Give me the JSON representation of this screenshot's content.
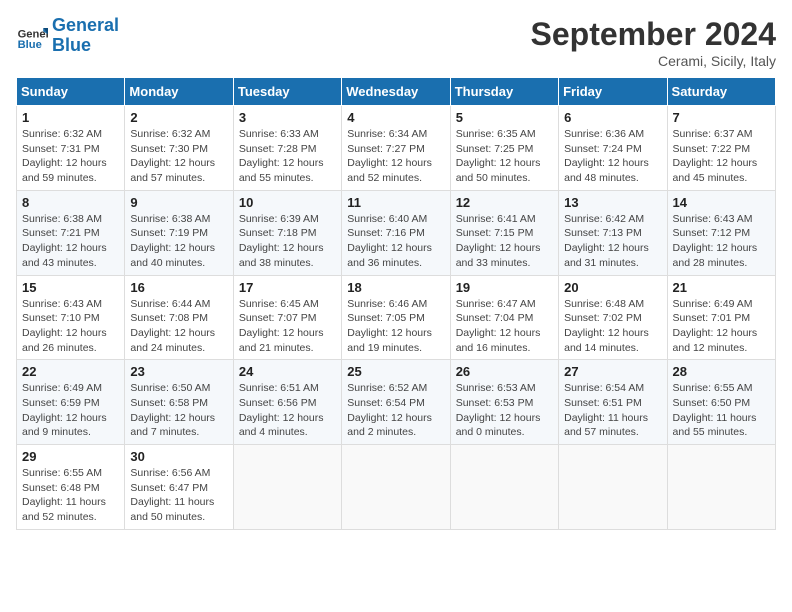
{
  "logo": {
    "general": "General",
    "blue": "Blue"
  },
  "header": {
    "month": "September 2024",
    "location": "Cerami, Sicily, Italy"
  },
  "weekdays": [
    "Sunday",
    "Monday",
    "Tuesday",
    "Wednesday",
    "Thursday",
    "Friday",
    "Saturday"
  ],
  "weeks": [
    [
      {
        "day": 1,
        "sunrise": "6:32 AM",
        "sunset": "7:31 PM",
        "daylight": "12 hours and 59 minutes."
      },
      {
        "day": 2,
        "sunrise": "6:32 AM",
        "sunset": "7:30 PM",
        "daylight": "12 hours and 57 minutes."
      },
      {
        "day": 3,
        "sunrise": "6:33 AM",
        "sunset": "7:28 PM",
        "daylight": "12 hours and 55 minutes."
      },
      {
        "day": 4,
        "sunrise": "6:34 AM",
        "sunset": "7:27 PM",
        "daylight": "12 hours and 52 minutes."
      },
      {
        "day": 5,
        "sunrise": "6:35 AM",
        "sunset": "7:25 PM",
        "daylight": "12 hours and 50 minutes."
      },
      {
        "day": 6,
        "sunrise": "6:36 AM",
        "sunset": "7:24 PM",
        "daylight": "12 hours and 48 minutes."
      },
      {
        "day": 7,
        "sunrise": "6:37 AM",
        "sunset": "7:22 PM",
        "daylight": "12 hours and 45 minutes."
      }
    ],
    [
      {
        "day": 8,
        "sunrise": "6:38 AM",
        "sunset": "7:21 PM",
        "daylight": "12 hours and 43 minutes."
      },
      {
        "day": 9,
        "sunrise": "6:38 AM",
        "sunset": "7:19 PM",
        "daylight": "12 hours and 40 minutes."
      },
      {
        "day": 10,
        "sunrise": "6:39 AM",
        "sunset": "7:18 PM",
        "daylight": "12 hours and 38 minutes."
      },
      {
        "day": 11,
        "sunrise": "6:40 AM",
        "sunset": "7:16 PM",
        "daylight": "12 hours and 36 minutes."
      },
      {
        "day": 12,
        "sunrise": "6:41 AM",
        "sunset": "7:15 PM",
        "daylight": "12 hours and 33 minutes."
      },
      {
        "day": 13,
        "sunrise": "6:42 AM",
        "sunset": "7:13 PM",
        "daylight": "12 hours and 31 minutes."
      },
      {
        "day": 14,
        "sunrise": "6:43 AM",
        "sunset": "7:12 PM",
        "daylight": "12 hours and 28 minutes."
      }
    ],
    [
      {
        "day": 15,
        "sunrise": "6:43 AM",
        "sunset": "7:10 PM",
        "daylight": "12 hours and 26 minutes."
      },
      {
        "day": 16,
        "sunrise": "6:44 AM",
        "sunset": "7:08 PM",
        "daylight": "12 hours and 24 minutes."
      },
      {
        "day": 17,
        "sunrise": "6:45 AM",
        "sunset": "7:07 PM",
        "daylight": "12 hours and 21 minutes."
      },
      {
        "day": 18,
        "sunrise": "6:46 AM",
        "sunset": "7:05 PM",
        "daylight": "12 hours and 19 minutes."
      },
      {
        "day": 19,
        "sunrise": "6:47 AM",
        "sunset": "7:04 PM",
        "daylight": "12 hours and 16 minutes."
      },
      {
        "day": 20,
        "sunrise": "6:48 AM",
        "sunset": "7:02 PM",
        "daylight": "12 hours and 14 minutes."
      },
      {
        "day": 21,
        "sunrise": "6:49 AM",
        "sunset": "7:01 PM",
        "daylight": "12 hours and 12 minutes."
      }
    ],
    [
      {
        "day": 22,
        "sunrise": "6:49 AM",
        "sunset": "6:59 PM",
        "daylight": "12 hours and 9 minutes."
      },
      {
        "day": 23,
        "sunrise": "6:50 AM",
        "sunset": "6:58 PM",
        "daylight": "12 hours and 7 minutes."
      },
      {
        "day": 24,
        "sunrise": "6:51 AM",
        "sunset": "6:56 PM",
        "daylight": "12 hours and 4 minutes."
      },
      {
        "day": 25,
        "sunrise": "6:52 AM",
        "sunset": "6:54 PM",
        "daylight": "12 hours and 2 minutes."
      },
      {
        "day": 26,
        "sunrise": "6:53 AM",
        "sunset": "6:53 PM",
        "daylight": "12 hours and 0 minutes."
      },
      {
        "day": 27,
        "sunrise": "6:54 AM",
        "sunset": "6:51 PM",
        "daylight": "11 hours and 57 minutes."
      },
      {
        "day": 28,
        "sunrise": "6:55 AM",
        "sunset": "6:50 PM",
        "daylight": "11 hours and 55 minutes."
      }
    ],
    [
      {
        "day": 29,
        "sunrise": "6:55 AM",
        "sunset": "6:48 PM",
        "daylight": "11 hours and 52 minutes."
      },
      {
        "day": 30,
        "sunrise": "6:56 AM",
        "sunset": "6:47 PM",
        "daylight": "11 hours and 50 minutes."
      },
      null,
      null,
      null,
      null,
      null
    ]
  ]
}
